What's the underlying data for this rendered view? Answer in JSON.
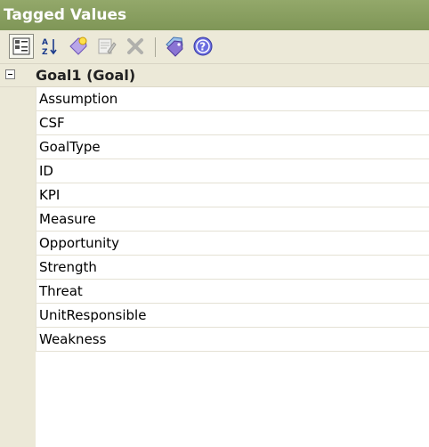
{
  "window": {
    "title": "Tagged Values"
  },
  "toolbar": {
    "buttons": [
      {
        "name": "categorized-view-button",
        "icon": "categorized-icon",
        "active": true
      },
      {
        "name": "alphabetical-sort-button",
        "icon": "sort-az-icon",
        "active": false
      },
      {
        "name": "new-tag-button",
        "icon": "new-tag-icon",
        "active": false
      },
      {
        "name": "edit-note-button",
        "icon": "edit-note-icon",
        "active": false
      },
      {
        "name": "delete-tag-button",
        "icon": "delete-icon",
        "active": false
      },
      {
        "name": "tag-library-button",
        "icon": "tag-icon",
        "active": false
      },
      {
        "name": "help-button",
        "icon": "help-icon",
        "active": false
      }
    ]
  },
  "grid": {
    "category": "Goal1 (Goal)",
    "rows": [
      "Assumption",
      "CSF",
      "GoalType",
      "ID",
      "KPI",
      "Measure",
      "Opportunity",
      "Strength",
      "Threat",
      "UnitResponsible",
      "Weakness"
    ]
  },
  "colors": {
    "title_bar": "#869d5d",
    "panel": "#ece9d8",
    "grid_line": "#e4e1d4"
  }
}
